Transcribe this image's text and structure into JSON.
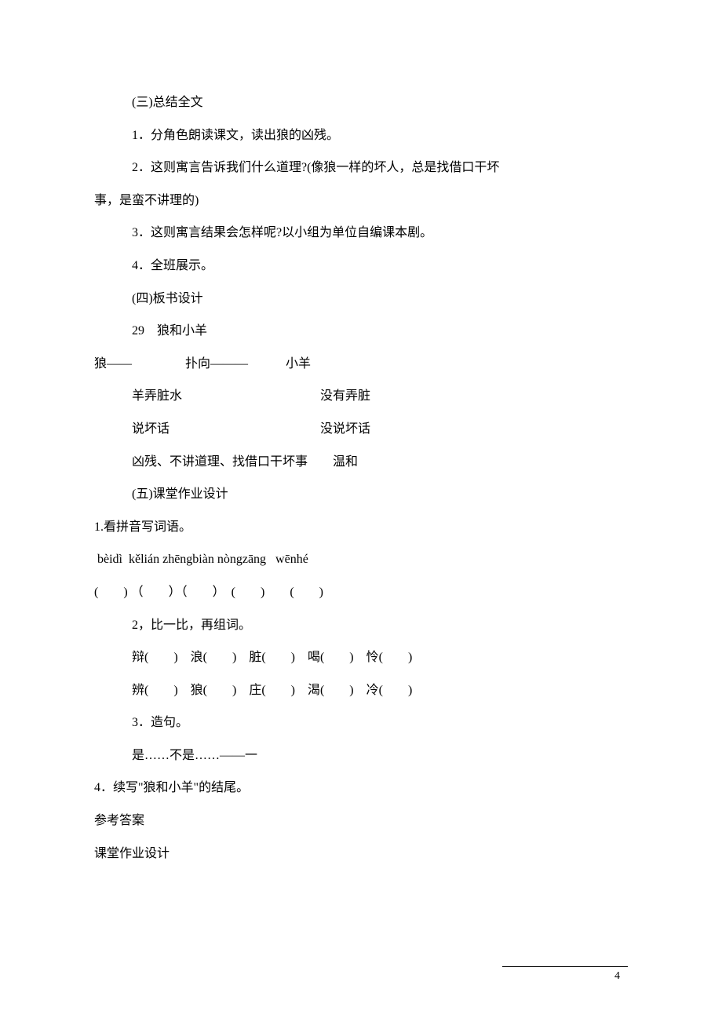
{
  "lines": {
    "l1": "(三)总结全文",
    "l2": "1．分角色朗读课文，读出狼的凶残。",
    "l3": "2．这则寓言告诉我们什么道理?(像狼一样的坏人，总是找借口干坏",
    "l4": "事，是蛮不讲理的)",
    "l5": "3．这则寓言结果会怎样呢?以小组为单位自编课本剧。",
    "l6": "4．全班展示。",
    "l7": "(四)板书设计",
    "l8": "29　狼和小羊",
    "l9": "狼——　　　　 扑向———　　　小羊",
    "l10": "羊弄脏水　　　　　　　　　　　没有弄脏",
    "l11": "说坏话　　　　　　　　　　　　没说坏话",
    "l12": "凶残、不讲道理、找借口干坏事　　温和",
    "l13": "(五)课堂作业设计",
    "l14": "1.看拼音写词语。",
    "l15": " bèidì  kělián zhēngbiàn nòngzāng   wēnhé",
    "l16": "(　　) （　　）（　　）　(　　)　　(　　)",
    "l17": "2，比一比，再组词。",
    "l18": "辩(　　)　浪(　　)　脏(　　)　喝(　　)　怜(　　)",
    "l19": "辨(　　)　狼(　　)　庄(　　)　渴(　　)　冷(　　)",
    "l20": "3．造句。",
    "l21": "是……不是……——一",
    "l22": "4．续写\"狼和小羊\"的结尾。",
    "l23": "参考答案",
    "l24": "课堂作业设计"
  },
  "pageNumber": "4"
}
